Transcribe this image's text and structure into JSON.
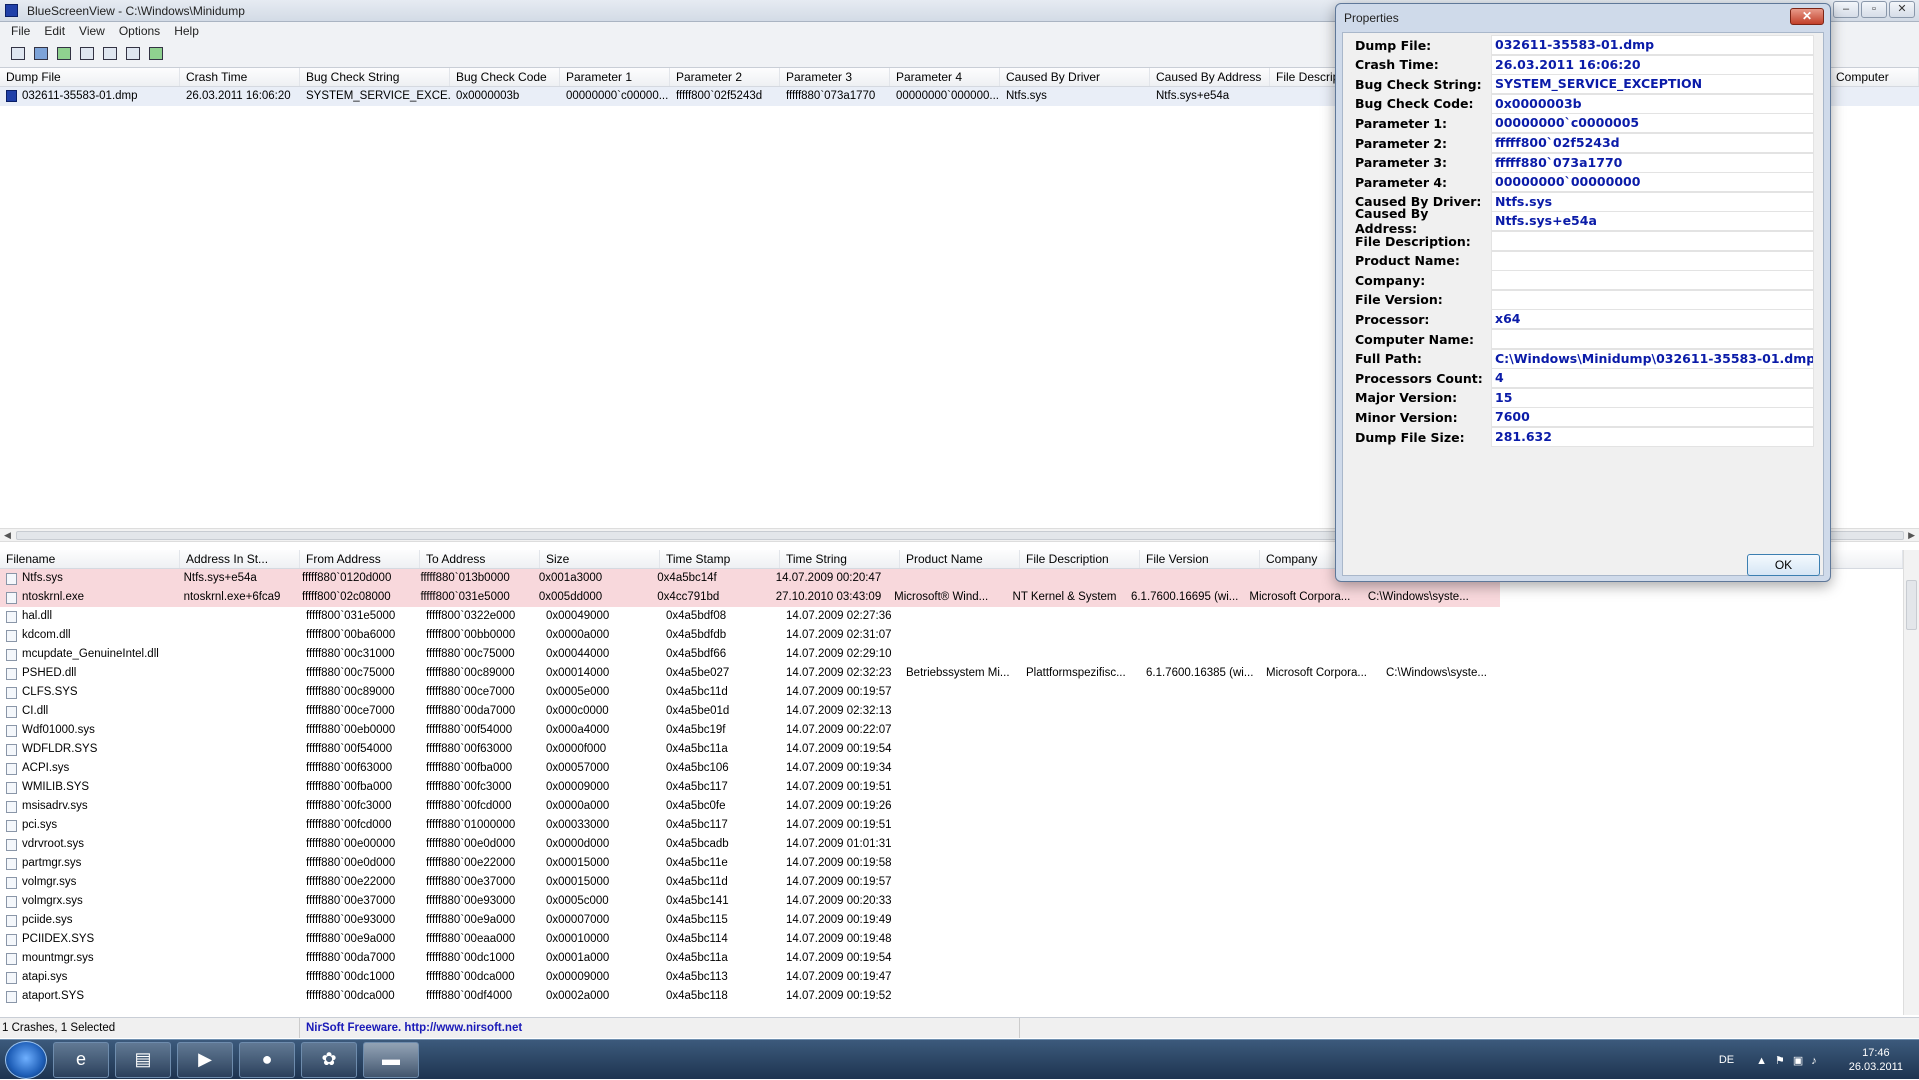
{
  "window": {
    "title": "BlueScreenView  -  C:\\Windows\\Minidump"
  },
  "menu": [
    "File",
    "Edit",
    "View",
    "Options",
    "Help"
  ],
  "top_columns": [
    "Dump File",
    "Crash Time",
    "Bug Check String",
    "Bug Check Code",
    "Parameter 1",
    "Parameter 2",
    "Parameter 3",
    "Parameter 4",
    "Caused By Driver",
    "Caused By Address",
    "File Descrip",
    "",
    "Computer"
  ],
  "top_row": [
    "032611-35583-01.dmp",
    "26.03.2011 16:06:20",
    "SYSTEM_SERVICE_EXCE...",
    "0x0000003b",
    "00000000`c00000...",
    "fffff800`02f5243d",
    "fffff880`073a1770",
    "00000000`000000...",
    "Ntfs.sys",
    "Ntfs.sys+e54a"
  ],
  "bottom_columns": [
    "Filename",
    "Address In St...",
    "From Address",
    "To Address",
    "Size",
    "Time Stamp",
    "Time String",
    "Product Name",
    "File Description",
    "File Version",
    "Company"
  ],
  "bottom_rows": [
    [
      "Ntfs.sys",
      "Ntfs.sys+e54a",
      "fffff880`0120d000",
      "fffff880`013b0000",
      "0x001a3000",
      "0x4a5bc14f",
      "14.07.2009 00:20:47",
      "",
      "",
      "",
      "",
      ""
    ],
    [
      "ntoskrnl.exe",
      "ntoskrnl.exe+6fca9",
      "fffff800`02c08000",
      "fffff800`031e5000",
      "0x005dd000",
      "0x4cc791bd",
      "27.10.2010 03:43:09",
      "Microsoft® Wind...",
      "NT Kernel & System",
      "6.1.7600.16695 (wi...",
      "Microsoft Corpora...",
      "C:\\Windows\\syste..."
    ],
    [
      "hal.dll",
      "",
      "fffff800`031e5000",
      "fffff800`0322e000",
      "0x00049000",
      "0x4a5bdf08",
      "14.07.2009 02:27:36",
      "",
      "",
      "",
      "",
      ""
    ],
    [
      "kdcom.dll",
      "",
      "fffff800`00ba6000",
      "fffff800`00bb0000",
      "0x0000a000",
      "0x4a5bdfdb",
      "14.07.2009 02:31:07",
      "",
      "",
      "",
      "",
      ""
    ],
    [
      "mcupdate_GenuineIntel.dll",
      "",
      "fffff880`00c31000",
      "fffff880`00c75000",
      "0x00044000",
      "0x4a5bdf66",
      "14.07.2009 02:29:10",
      "",
      "",
      "",
      "",
      ""
    ],
    [
      "PSHED.dll",
      "",
      "fffff880`00c75000",
      "fffff880`00c89000",
      "0x00014000",
      "0x4a5be027",
      "14.07.2009 02:32:23",
      "Betriebssystem Mi...",
      "Plattformspezifisc...",
      "6.1.7600.16385 (wi...",
      "Microsoft Corpora...",
      "C:\\Windows\\syste..."
    ],
    [
      "CLFS.SYS",
      "",
      "fffff880`00c89000",
      "fffff880`00ce7000",
      "0x0005e000",
      "0x4a5bc11d",
      "14.07.2009 00:19:57",
      "",
      "",
      "",
      "",
      ""
    ],
    [
      "CI.dll",
      "",
      "fffff880`00ce7000",
      "fffff880`00da7000",
      "0x000c0000",
      "0x4a5be01d",
      "14.07.2009 02:32:13",
      "",
      "",
      "",
      "",
      ""
    ],
    [
      "Wdf01000.sys",
      "",
      "fffff880`00eb0000",
      "fffff880`00f54000",
      "0x000a4000",
      "0x4a5bc19f",
      "14.07.2009 00:22:07",
      "",
      "",
      "",
      "",
      ""
    ],
    [
      "WDFLDR.SYS",
      "",
      "fffff880`00f54000",
      "fffff880`00f63000",
      "0x0000f000",
      "0x4a5bc11a",
      "14.07.2009 00:19:54",
      "",
      "",
      "",
      "",
      ""
    ],
    [
      "ACPI.sys",
      "",
      "fffff880`00f63000",
      "fffff880`00fba000",
      "0x00057000",
      "0x4a5bc106",
      "14.07.2009 00:19:34",
      "",
      "",
      "",
      "",
      ""
    ],
    [
      "WMILIB.SYS",
      "",
      "fffff880`00fba000",
      "fffff880`00fc3000",
      "0x00009000",
      "0x4a5bc117",
      "14.07.2009 00:19:51",
      "",
      "",
      "",
      "",
      ""
    ],
    [
      "msisadrv.sys",
      "",
      "fffff880`00fc3000",
      "fffff880`00fcd000",
      "0x0000a000",
      "0x4a5bc0fe",
      "14.07.2009 00:19:26",
      "",
      "",
      "",
      "",
      ""
    ],
    [
      "pci.sys",
      "",
      "fffff880`00fcd000",
      "fffff880`01000000",
      "0x00033000",
      "0x4a5bc117",
      "14.07.2009 00:19:51",
      "",
      "",
      "",
      "",
      ""
    ],
    [
      "vdrvroot.sys",
      "",
      "fffff880`00e00000",
      "fffff880`00e0d000",
      "0x0000d000",
      "0x4a5bcadb",
      "14.07.2009 01:01:31",
      "",
      "",
      "",
      "",
      ""
    ],
    [
      "partmgr.sys",
      "",
      "fffff880`00e0d000",
      "fffff880`00e22000",
      "0x00015000",
      "0x4a5bc11e",
      "14.07.2009 00:19:58",
      "",
      "",
      "",
      "",
      ""
    ],
    [
      "volmgr.sys",
      "",
      "fffff880`00e22000",
      "fffff880`00e37000",
      "0x00015000",
      "0x4a5bc11d",
      "14.07.2009 00:19:57",
      "",
      "",
      "",
      "",
      ""
    ],
    [
      "volmgrx.sys",
      "",
      "fffff880`00e37000",
      "fffff880`00e93000",
      "0x0005c000",
      "0x4a5bc141",
      "14.07.2009 00:20:33",
      "",
      "",
      "",
      "",
      ""
    ],
    [
      "pciide.sys",
      "",
      "fffff880`00e93000",
      "fffff880`00e9a000",
      "0x00007000",
      "0x4a5bc115",
      "14.07.2009 00:19:49",
      "",
      "",
      "",
      "",
      ""
    ],
    [
      "PCIIDEX.SYS",
      "",
      "fffff880`00e9a000",
      "fffff880`00eaa000",
      "0x00010000",
      "0x4a5bc114",
      "14.07.2009 00:19:48",
      "",
      "",
      "",
      "",
      ""
    ],
    [
      "mountmgr.sys",
      "",
      "fffff880`00da7000",
      "fffff880`00dc1000",
      "0x0001a000",
      "0x4a5bc11a",
      "14.07.2009 00:19:54",
      "",
      "",
      "",
      "",
      ""
    ],
    [
      "atapi.sys",
      "",
      "fffff880`00dc1000",
      "fffff880`00dca000",
      "0x00009000",
      "0x4a5bc113",
      "14.07.2009 00:19:47",
      "",
      "",
      "",
      "",
      ""
    ],
    [
      "ataport.SYS",
      "",
      "fffff880`00dca000",
      "fffff880`00df4000",
      "0x0002a000",
      "0x4a5bc118",
      "14.07.2009 00:19:52",
      "",
      "",
      "",
      "",
      ""
    ]
  ],
  "status": {
    "left": "1 Crashes, 1 Selected",
    "right": "NirSoft Freeware.  http://www.nirsoft.net"
  },
  "dialog": {
    "title": "Properties",
    "close": "✕",
    "ok": "OK",
    "props": [
      {
        "label": "Dump File:",
        "value": "032611-35583-01.dmp"
      },
      {
        "label": "Crash Time:",
        "value": "26.03.2011 16:06:20"
      },
      {
        "label": "Bug Check String:",
        "value": "SYSTEM_SERVICE_EXCEPTION"
      },
      {
        "label": "Bug Check Code:",
        "value": "0x0000003b"
      },
      {
        "label": "Parameter 1:",
        "value": "00000000`c0000005"
      },
      {
        "label": "Parameter 2:",
        "value": "fffff800`02f5243d"
      },
      {
        "label": "Parameter 3:",
        "value": "fffff880`073a1770"
      },
      {
        "label": "Parameter 4:",
        "value": "00000000`00000000"
      },
      {
        "label": "Caused By Driver:",
        "value": "Ntfs.sys"
      },
      {
        "label": "Caused By Address:",
        "value": "Ntfs.sys+e54a"
      },
      {
        "label": "File Description:",
        "value": ""
      },
      {
        "label": "Product Name:",
        "value": ""
      },
      {
        "label": "Company:",
        "value": ""
      },
      {
        "label": "File Version:",
        "value": ""
      },
      {
        "label": "Processor:",
        "value": "x64"
      },
      {
        "label": "Computer Name:",
        "value": ""
      },
      {
        "label": "Full Path:",
        "value": "C:\\Windows\\Minidump\\032611-35583-01.dmp"
      },
      {
        "label": "Processors Count:",
        "value": "4"
      },
      {
        "label": "Major Version:",
        "value": "15"
      },
      {
        "label": "Minor Version:",
        "value": "7600"
      },
      {
        "label": "Dump File Size:",
        "value": "281.632"
      }
    ]
  },
  "taskbar": {
    "lang": "DE",
    "time": "17:46",
    "date": "26.03.2011"
  }
}
